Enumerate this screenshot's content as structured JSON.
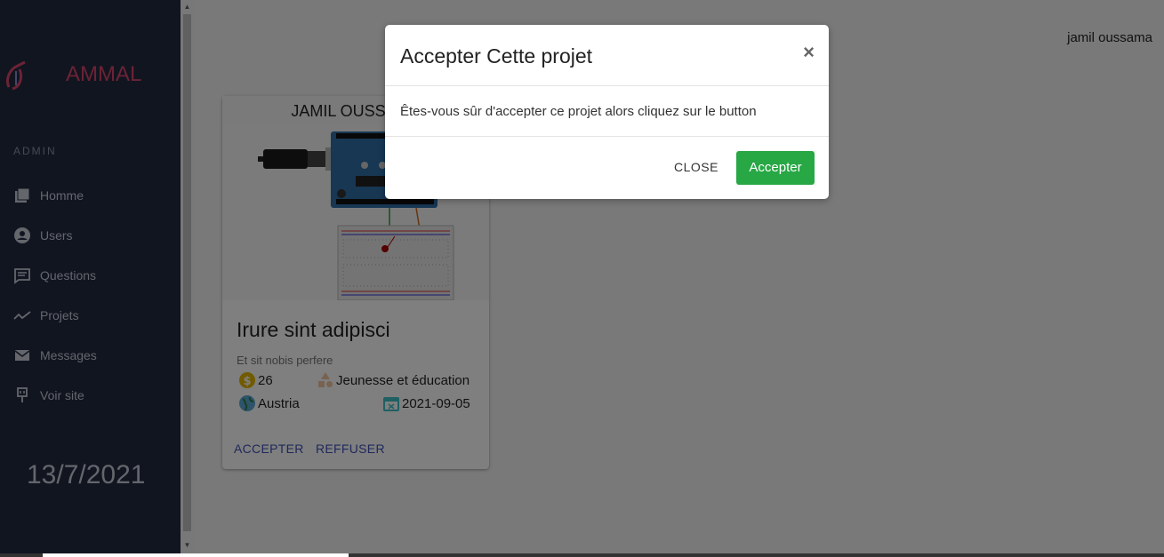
{
  "sidebar": {
    "brand": "AMMAL",
    "section": "ADMIN",
    "items": [
      {
        "label": "Homme",
        "icon": "library-icon"
      },
      {
        "label": "Users",
        "icon": "user-circle-icon"
      },
      {
        "label": "Questions",
        "icon": "comment-icon"
      },
      {
        "label": "Projets",
        "icon": "trending-icon"
      },
      {
        "label": "Messages",
        "icon": "mail-icon"
      },
      {
        "label": "Voir site",
        "icon": "plug-icon"
      }
    ],
    "date": "13/7/2021"
  },
  "header": {
    "user": "jamil oussama"
  },
  "card": {
    "owner": "JAMIL OUSSAMA",
    "title": "Irure sint adipisci",
    "subtitle": "Et sit nobis perfere",
    "price": "26",
    "category": "Jeunesse et éducation",
    "country": "Austria",
    "date": "2021-09-05",
    "accept_label": "ACCEPTER",
    "refuse_label": "REFFUSER"
  },
  "modal": {
    "title": "Accepter Cette projet",
    "close_symbol": "×",
    "body": "Êtes-vous sûr d'accepter ce projet alors cliquez sur le button",
    "close_label": "CLOSE",
    "accept_label": "Accepter"
  },
  "colors": {
    "brand": "#d6476b",
    "sidebar": "#232a40",
    "accept": "#28a745",
    "link": "#3f51b5"
  }
}
